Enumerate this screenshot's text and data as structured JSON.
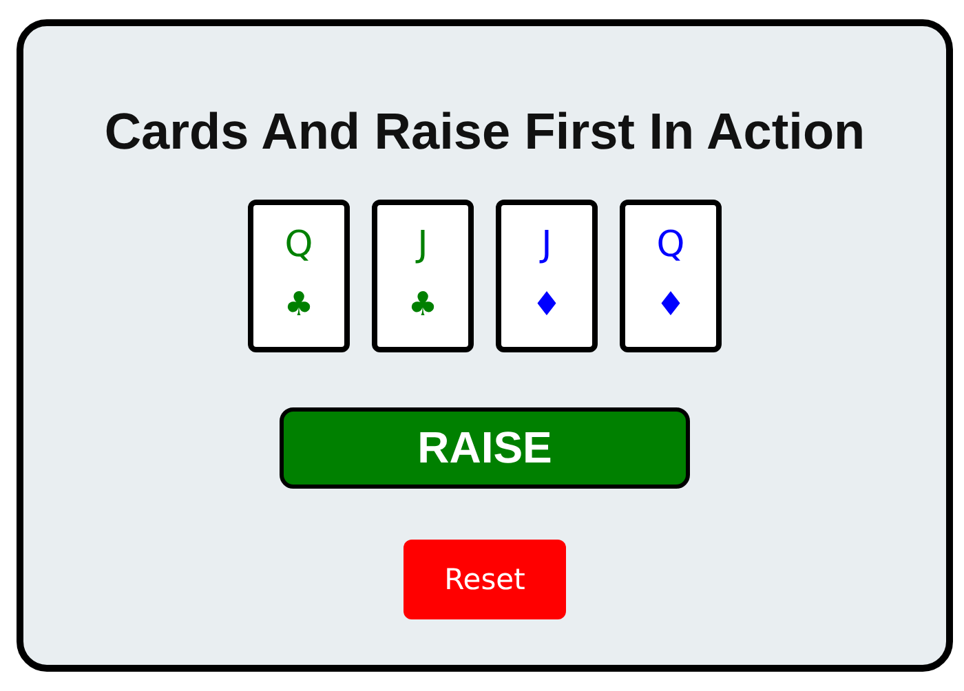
{
  "title": "Cards And Raise First In Action",
  "cards": [
    {
      "rank": "Q",
      "suit": "♣",
      "color": "#008000"
    },
    {
      "rank": "J",
      "suit": "♣",
      "color": "#008000"
    },
    {
      "rank": "J",
      "suit": "♦",
      "color": "#0000ff"
    },
    {
      "rank": "Q",
      "suit": "♦",
      "color": "#0000ff"
    }
  ],
  "action_button": "RAISE",
  "reset_button": "Reset"
}
